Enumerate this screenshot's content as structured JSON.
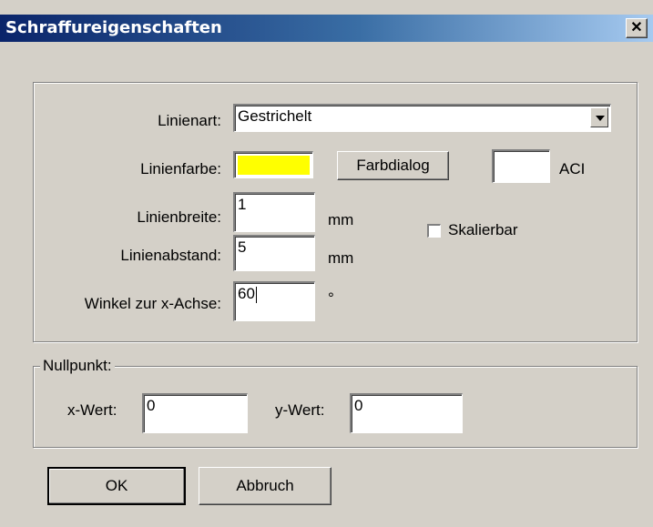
{
  "window": {
    "title": "Schraffureigenschaften",
    "close_glyph": "✕"
  },
  "line": {
    "type_label": "Linienart:",
    "type_value": "Gestrichelt",
    "color_label": "Linienfarbe:",
    "color_value": "#ffff00",
    "color_dialog_button": "Farbdialog",
    "aci_value": "",
    "aci_label": "ACI",
    "width_label": "Linienbreite:",
    "width_value": "1",
    "width_unit": "mm",
    "spacing_label": "Linienabstand:",
    "spacing_value": "5",
    "spacing_unit": "mm",
    "angle_label": "Winkel zur x-Achse:",
    "angle_value": "60",
    "angle_unit": "°",
    "scalable_label": "Skalierbar",
    "scalable_checked": false
  },
  "origin": {
    "legend": "Nullpunkt:",
    "x_label": "x-Wert:",
    "x_value": "0",
    "y_label": "y-Wert:",
    "y_value": "0"
  },
  "buttons": {
    "ok": "OK",
    "cancel": "Abbruch"
  }
}
